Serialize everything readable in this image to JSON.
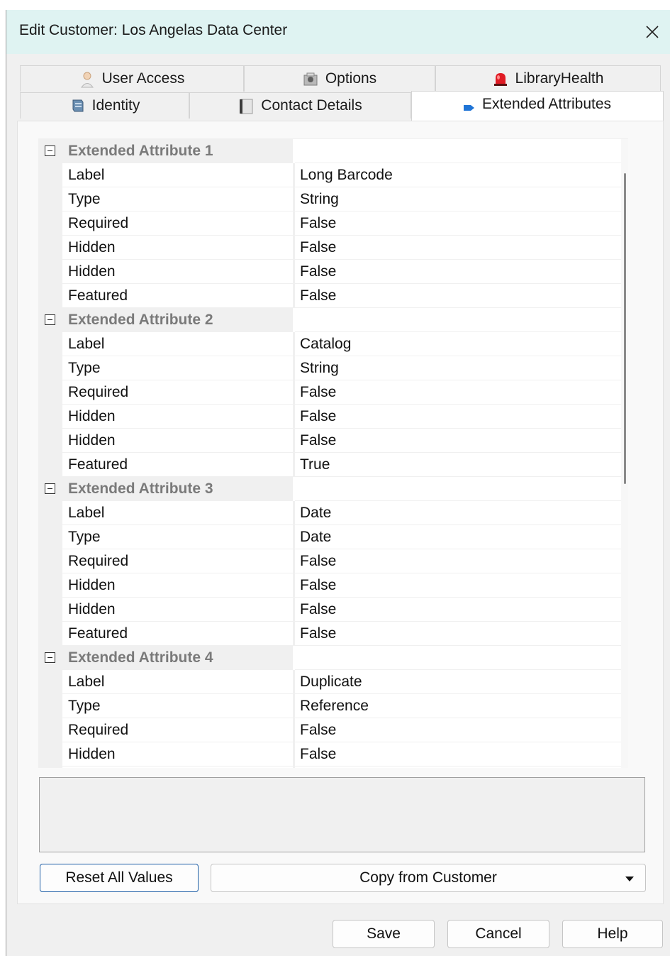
{
  "window": {
    "title": "Edit Customer: Los Angelas Data Center"
  },
  "tabs_back": [
    {
      "label": "User Access",
      "icon": "user-icon"
    },
    {
      "label": "Options",
      "icon": "options-icon"
    },
    {
      "label": "LibraryHealth",
      "icon": "alarm-light-icon"
    }
  ],
  "tabs_front": [
    {
      "label": "Identity",
      "icon": "server-icon"
    },
    {
      "label": "Contact Details",
      "icon": "address-book-icon"
    },
    {
      "label": "Extended Attributes",
      "icon": "tag-icon",
      "active": true
    }
  ],
  "grid": {
    "categories": [
      {
        "title": "Extended Attribute 1",
        "rows": [
          {
            "name": "Label",
            "value": "Long Barcode"
          },
          {
            "name": "Type",
            "value": "String"
          },
          {
            "name": "Required",
            "value": "False"
          },
          {
            "name": "Hidden",
            "value": "False"
          },
          {
            "name": "Hidden",
            "value": "False"
          },
          {
            "name": "Featured",
            "value": "False"
          }
        ]
      },
      {
        "title": "Extended Attribute 2",
        "rows": [
          {
            "name": "Label",
            "value": "Catalog"
          },
          {
            "name": "Type",
            "value": "String"
          },
          {
            "name": "Required",
            "value": "False"
          },
          {
            "name": "Hidden",
            "value": "False"
          },
          {
            "name": "Hidden",
            "value": "False"
          },
          {
            "name": "Featured",
            "value": "True"
          }
        ]
      },
      {
        "title": "Extended Attribute 3",
        "rows": [
          {
            "name": "Label",
            "value": "Date"
          },
          {
            "name": "Type",
            "value": "Date"
          },
          {
            "name": "Required",
            "value": "False"
          },
          {
            "name": "Hidden",
            "value": "False"
          },
          {
            "name": "Hidden",
            "value": "False"
          },
          {
            "name": "Featured",
            "value": "False"
          }
        ]
      },
      {
        "title": "Extended Attribute 4",
        "rows": [
          {
            "name": "Label",
            "value": "Duplicate"
          },
          {
            "name": "Type",
            "value": "Reference"
          },
          {
            "name": "Required",
            "value": "False"
          },
          {
            "name": "Hidden",
            "value": "False"
          },
          {
            "name": "",
            "value": ""
          }
        ]
      }
    ]
  },
  "buttons": {
    "reset": "Reset All Values",
    "copy_from": "Copy from Customer",
    "save": "Save",
    "cancel": "Cancel",
    "help": "Help"
  }
}
